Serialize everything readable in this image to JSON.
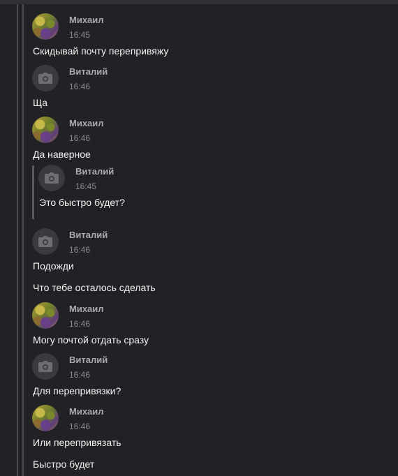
{
  "messages": [
    {
      "author": "Михаил",
      "time": "16:45",
      "lines": [
        "Скидывай почту перепривяжу"
      ],
      "avatar": "photo-avatar"
    },
    {
      "author": "Виталий",
      "time": "16:46",
      "lines": [
        "Ща"
      ],
      "avatar": "camera-icon"
    },
    {
      "author": "Михаил",
      "time": "16:46",
      "lines": [
        "Да наверное"
      ],
      "avatar": "photo-avatar"
    },
    {
      "author": "Виталий",
      "time": "16:45",
      "lines": [
        "Это быстро будет?"
      ],
      "avatar": "camera-icon",
      "quoted": true
    },
    {
      "author": "Виталий",
      "time": "16:46",
      "lines": [
        "Подожди",
        "Что тебе осталось сделать"
      ],
      "avatar": "camera-icon"
    },
    {
      "author": "Михаил",
      "time": "16:46",
      "lines": [
        "Могу почтой отдать сразу"
      ],
      "avatar": "photo-avatar"
    },
    {
      "author": "Виталий",
      "time": "16:46",
      "lines": [
        "Для перепривязки?"
      ],
      "avatar": "camera-icon"
    },
    {
      "author": "Михаил",
      "time": "16:46",
      "lines": [
        "Или перепривязать",
        "Быстро будет"
      ],
      "avatar": "photo-avatar"
    }
  ]
}
